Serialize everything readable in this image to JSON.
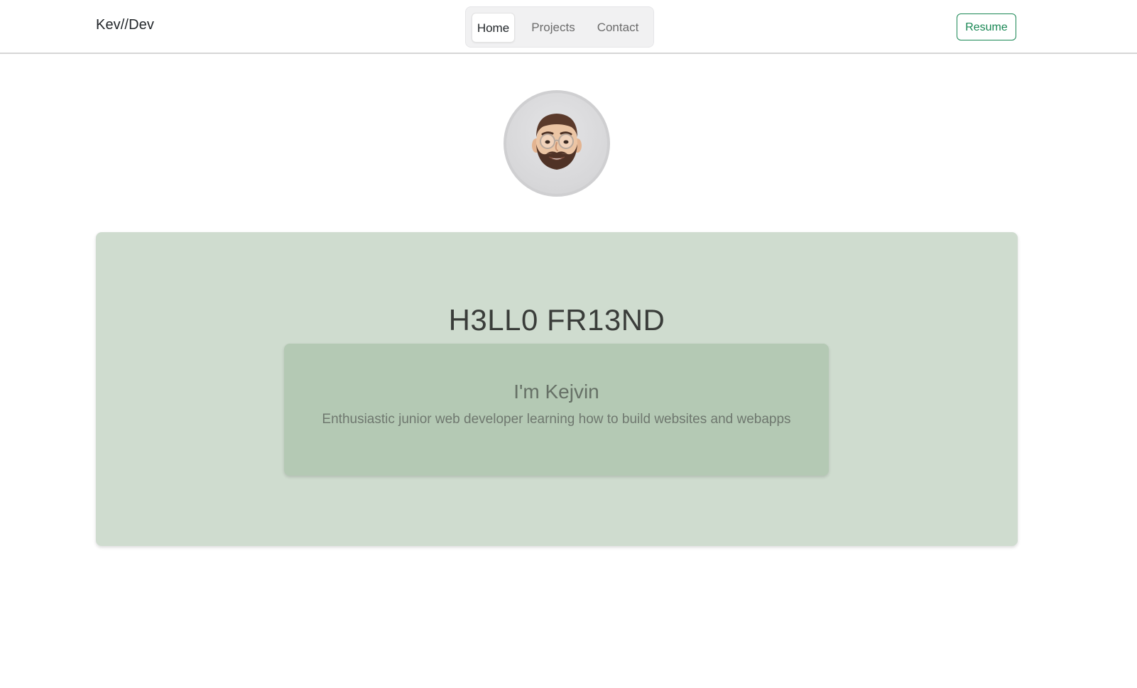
{
  "navbar": {
    "brand": "Kev//Dev",
    "tabs": [
      {
        "label": "Home",
        "active": true
      },
      {
        "label": "Projects",
        "active": false
      },
      {
        "label": "Contact",
        "active": false
      }
    ],
    "resume_label": "Resume",
    "accent_color": "#198754"
  },
  "hero": {
    "title": "H3LL0 FR13ND",
    "card": {
      "name": "I'm Kejvin",
      "tagline": "Enthusiastic junior web developer learning how to build websites and webapps"
    },
    "background_color": "#cfdccf",
    "card_color": "#b4c9b4"
  },
  "avatar": {
    "icon": "memoji-avatar-icon"
  }
}
